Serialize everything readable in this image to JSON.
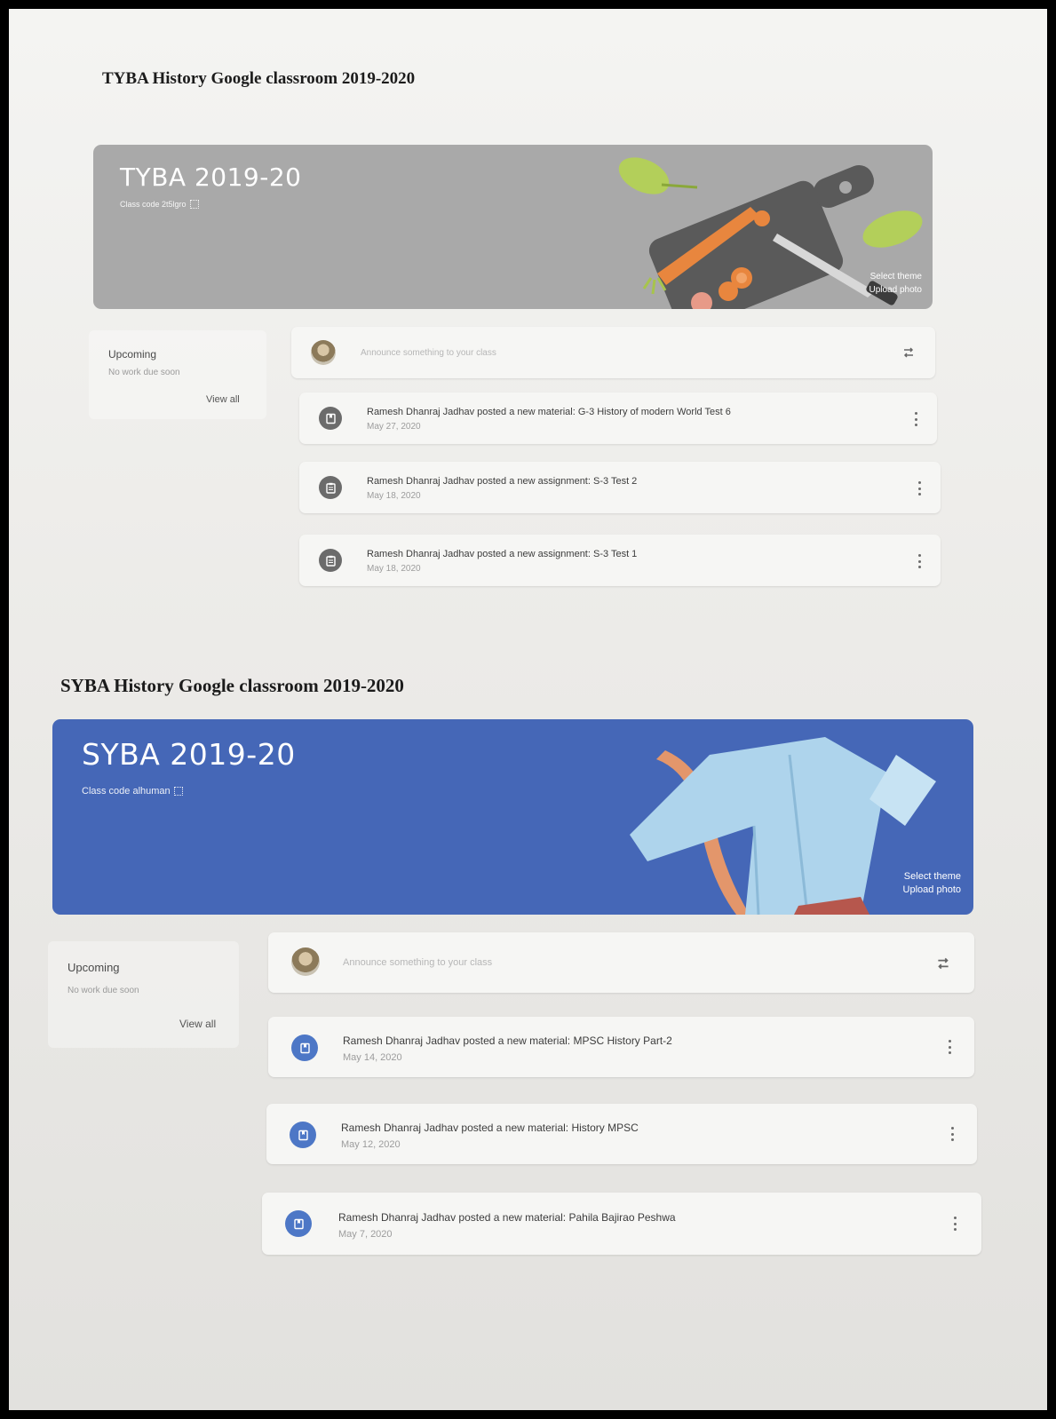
{
  "colors": {
    "tyba_banner": "#a9a9a9",
    "syba_banner": "#4567b7",
    "tyba_post_icon": "#6b6b6b",
    "syba_post_icon": "#4d77c6",
    "sheet": "#eeeeec"
  },
  "sections": [
    {
      "heading": "TYBA History Google classroom 2019-2020",
      "banner": {
        "class_name": "TYBA 2019-20",
        "class_code": "Class code 2t5lgro",
        "select_theme": "Select theme",
        "upload_photo": "Upload photo",
        "illustration": "cutting-board-vegetables-icon"
      },
      "upcoming": {
        "title": "Upcoming",
        "empty": "No work due soon",
        "view_all": "View all"
      },
      "announce": {
        "placeholder": "Announce something to your class",
        "icon": "repost-icon"
      },
      "posts": [
        {
          "icon": "material-icon",
          "text": "Ramesh Dhanraj Jadhav posted a new material: G-3 History of modern World Test 6",
          "date": "May 27, 2020"
        },
        {
          "icon": "assignment-icon",
          "text": "Ramesh Dhanraj Jadhav posted a new assignment: S-3 Test 2",
          "date": "May 18, 2020"
        },
        {
          "icon": "assignment-icon",
          "text": "Ramesh Dhanraj Jadhav posted a new assignment: S-3 Test 1",
          "date": "May 18, 2020"
        }
      ]
    },
    {
      "heading": "SYBA History Google classroom 2019-2020",
      "banner": {
        "class_name": "SYBA 2019-20",
        "class_code": "Class code alhuman",
        "select_theme": "Select theme",
        "upload_photo": "Upload photo",
        "illustration": "jacket-tape-measure-icon"
      },
      "upcoming": {
        "title": "Upcoming",
        "empty": "No work due soon",
        "view_all": "View all"
      },
      "announce": {
        "placeholder": "Announce something to your class",
        "icon": "repost-icon"
      },
      "posts": [
        {
          "icon": "material-icon",
          "text": "Ramesh Dhanraj Jadhav posted a new material: MPSC History Part-2",
          "date": "May 14, 2020"
        },
        {
          "icon": "material-icon",
          "text": "Ramesh Dhanraj Jadhav posted a new material: History MPSC",
          "date": "May 12, 2020"
        },
        {
          "icon": "material-icon",
          "text": "Ramesh Dhanraj Jadhav posted a new material: Pahila Bajirao Peshwa",
          "date": "May 7, 2020"
        }
      ]
    }
  ]
}
